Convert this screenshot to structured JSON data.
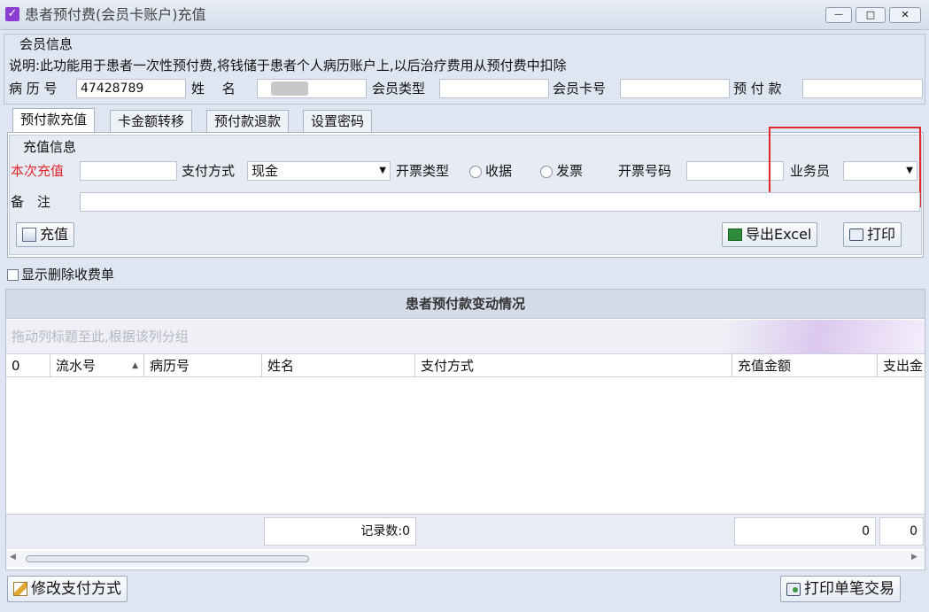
{
  "window": {
    "title": "患者预付费(会员卡账户)充值",
    "controls": [
      "—",
      "□",
      "✕"
    ]
  },
  "member": {
    "group_title": "会员信息",
    "description": "说明:此功能用于患者一次性预付费,将钱储于患者个人病历账户上,以后治疗费用从预付费中扣除",
    "record_no_label": "病 历 号",
    "record_no_value": "47428789",
    "name_label": "姓　 名",
    "name_value": "",
    "type_label": "会员类型",
    "type_value": "",
    "card_label": "会员卡号",
    "card_value": "",
    "prepay_label": "预 付 款",
    "prepay_value": ""
  },
  "tabs": [
    "预付款充值",
    "卡金额转移",
    "预付款退款",
    "设置密码"
  ],
  "recharge": {
    "group_title": "充值信息",
    "amount_label": "本次充值",
    "amount_value": "",
    "pay_method_label": "支付方式",
    "pay_method_value": "现金",
    "invoice_type_label": "开票类型",
    "radio_receipt": "收据",
    "radio_invoice": "发票",
    "invoice_no_label": "开票号码",
    "invoice_no_value": "",
    "staff_label": "业务员",
    "staff_value": "",
    "remark_label": "备　注",
    "remark_value": "",
    "recharge_button": "充值",
    "export_button": "导出Excel",
    "print_button": "打印"
  },
  "show_deleted_label": "显示删除收费单",
  "grid": {
    "title": "患者预付款变动情况",
    "group_hint": "拖动列标题至此,根据该列分组",
    "columns": [
      "0",
      "流水号",
      "病历号",
      "姓名",
      "支付方式",
      "充值金额",
      "支出金"
    ],
    "record_count": "记录数:0",
    "sum_recharge": "0",
    "sum_expense": "0"
  },
  "bottom": {
    "modify_button": "修改支付方式",
    "print_single_button": "打印单笔交易"
  },
  "colors": {
    "highlight_box": "#e0282d",
    "required_label": "#e0282d",
    "title_check": "#8a3fd1"
  }
}
